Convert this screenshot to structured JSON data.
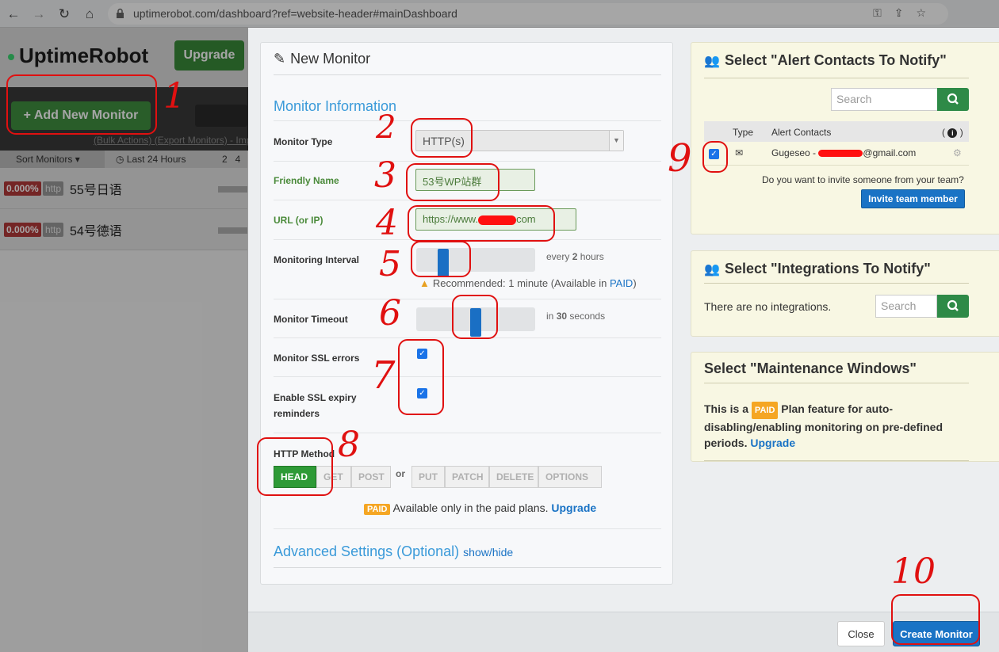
{
  "browser": {
    "url": "uptimerobot.com/dashboard?ref=website-header#mainDashboard"
  },
  "background_app": {
    "logo": "UptimeRobot",
    "upgrade_label": "Upgrade",
    "add_monitor_label": "+ Add New Monitor",
    "bulk_links": "(Bulk Actions) (Export Monitors) - Imp",
    "sort_label": "Sort Monitors ▾",
    "last24_label": "◷ Last 24 Hours",
    "col_nums": "2   4",
    "monitors": [
      {
        "pct": "0.000%",
        "type": "http",
        "name": "55号日语"
      },
      {
        "pct": "0.000%",
        "type": "http",
        "name": "54号德语"
      }
    ]
  },
  "form": {
    "title": "New Monitor",
    "section_info": "Monitor Information",
    "monitor_type_label": "Monitor Type",
    "monitor_type_value": "HTTP(s)",
    "friendly_name_label": "Friendly Name",
    "friendly_name_value": "53号WP站群",
    "url_label": "URL (or IP)",
    "url_prefix": "https://www.",
    "url_suffix": "com",
    "interval_label": "Monitoring Interval",
    "interval_note_pre": "every",
    "interval_note_val": "2",
    "interval_note_post": "hours",
    "interval_level": 0.2,
    "recommend_text": "Recommended: 1 minute (Available in",
    "recommend_paid": "PAID",
    "recommend_close": ")",
    "timeout_label": "Monitor Timeout",
    "timeout_note_pre": "in",
    "timeout_note_val": "30",
    "timeout_note_post": "seconds",
    "timeout_level": 0.5,
    "ssl_errors_label": "Monitor SSL errors",
    "ssl_errors_checked": true,
    "ssl_expiry_label_1": "Enable SSL expiry",
    "ssl_expiry_label_2": "reminders",
    "ssl_expiry_checked": true,
    "http_method_label": "HTTP Method",
    "methods": [
      "HEAD",
      "GET",
      "POST",
      "PUT",
      "PATCH",
      "DELETE",
      "OPTIONS"
    ],
    "selected_method": "HEAD",
    "or_text": "or",
    "paid_badge": "PAID",
    "paid_text": "Available only in the paid plans.",
    "paid_upgrade": "Upgrade",
    "advanced_label": "Advanced Settings (Optional)",
    "advanced_toggle": "show/hide"
  },
  "alert_contacts": {
    "title": "Select \"Alert Contacts To Notify\"",
    "search_placeholder": "Search",
    "col_type": "Type",
    "col_contact": "Alert Contacts",
    "col_info_open": "(",
    "col_info_close": ")",
    "contact_prefix": "Gugeseo -",
    "contact_suffix": "@gmail.com",
    "contact_checked": true,
    "invite_question": "Do you want to invite someone from your team?",
    "invite_button": "Invite team member"
  },
  "integrations": {
    "title": "Select \"Integrations To Notify\"",
    "none_text": "There are no integrations.",
    "search_placeholder": "Search"
  },
  "maintenance": {
    "title": "Select \"Maintenance Windows\"",
    "text_1": "This is a",
    "paid_badge": "PAID",
    "text_2": "Plan feature for auto-",
    "text_3": "disabling/enabling monitoring on pre-defined",
    "text_4": "periods.",
    "upgrade": "Upgrade"
  },
  "footer": {
    "close_label": "Close",
    "create_label": "Create Monitor"
  },
  "annotations": [
    "1",
    "2",
    "3",
    "4",
    "5",
    "6",
    "7",
    "8",
    "9",
    "10"
  ],
  "colors": {
    "accent_blue": "#1a73c5",
    "section_blue": "#3a9ad9",
    "method_active": "#2e9a36",
    "paid_orange": "#f5a623",
    "annotation_red": "#e01010"
  }
}
